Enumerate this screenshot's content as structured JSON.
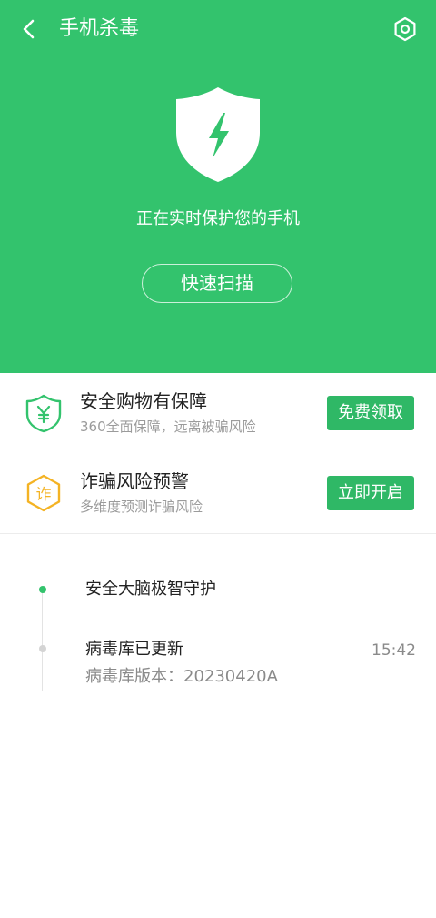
{
  "header": {
    "title": "手机杀毒",
    "back_icon": "chevron-left-icon",
    "settings_icon": "hexagon-settings-icon"
  },
  "hero": {
    "shield_icon": "shield-lightning-icon",
    "status_text": "正在实时保护您的手机",
    "scan_button_label": "快速扫描",
    "background_color": "#33c36d"
  },
  "promos": [
    {
      "icon": "shield-yuan-icon",
      "title": "安全购物有保障",
      "subtitle": "360全面保障，远离被骗风险",
      "button_label": "免费领取"
    },
    {
      "icon": "fraud-warning-icon",
      "icon_text": "诈",
      "title": "诈骗风险预警",
      "subtitle": "多维度预测诈骗风险",
      "button_label": "立即开启"
    }
  ],
  "timeline": {
    "items": [
      {
        "title": "安全大脑极智守护"
      },
      {
        "title": "病毒库已更新",
        "time": "15:42",
        "detail": "病毒库版本：20230420A"
      }
    ]
  }
}
